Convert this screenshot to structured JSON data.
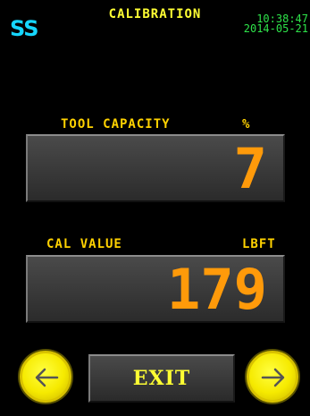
{
  "header": {
    "logo": "SS",
    "title": "CALIBRATION",
    "time": "10:38:47",
    "date": "2014-05-21"
  },
  "fields": [
    {
      "label": "TOOL CAPACITY",
      "unit": "%",
      "value": "7"
    },
    {
      "label": "CAL VALUE",
      "unit": "LBFT",
      "value": "179"
    }
  ],
  "footer": {
    "prev_icon": "arrow-left-icon",
    "next_icon": "arrow-right-icon",
    "exit_label": "EXIT"
  },
  "colors": {
    "logo": "#16d6ff",
    "title": "#ffff33",
    "clock": "#2ee34a",
    "label": "#ffd200",
    "value": "#ff9a0a",
    "button": "#f6ea00"
  }
}
